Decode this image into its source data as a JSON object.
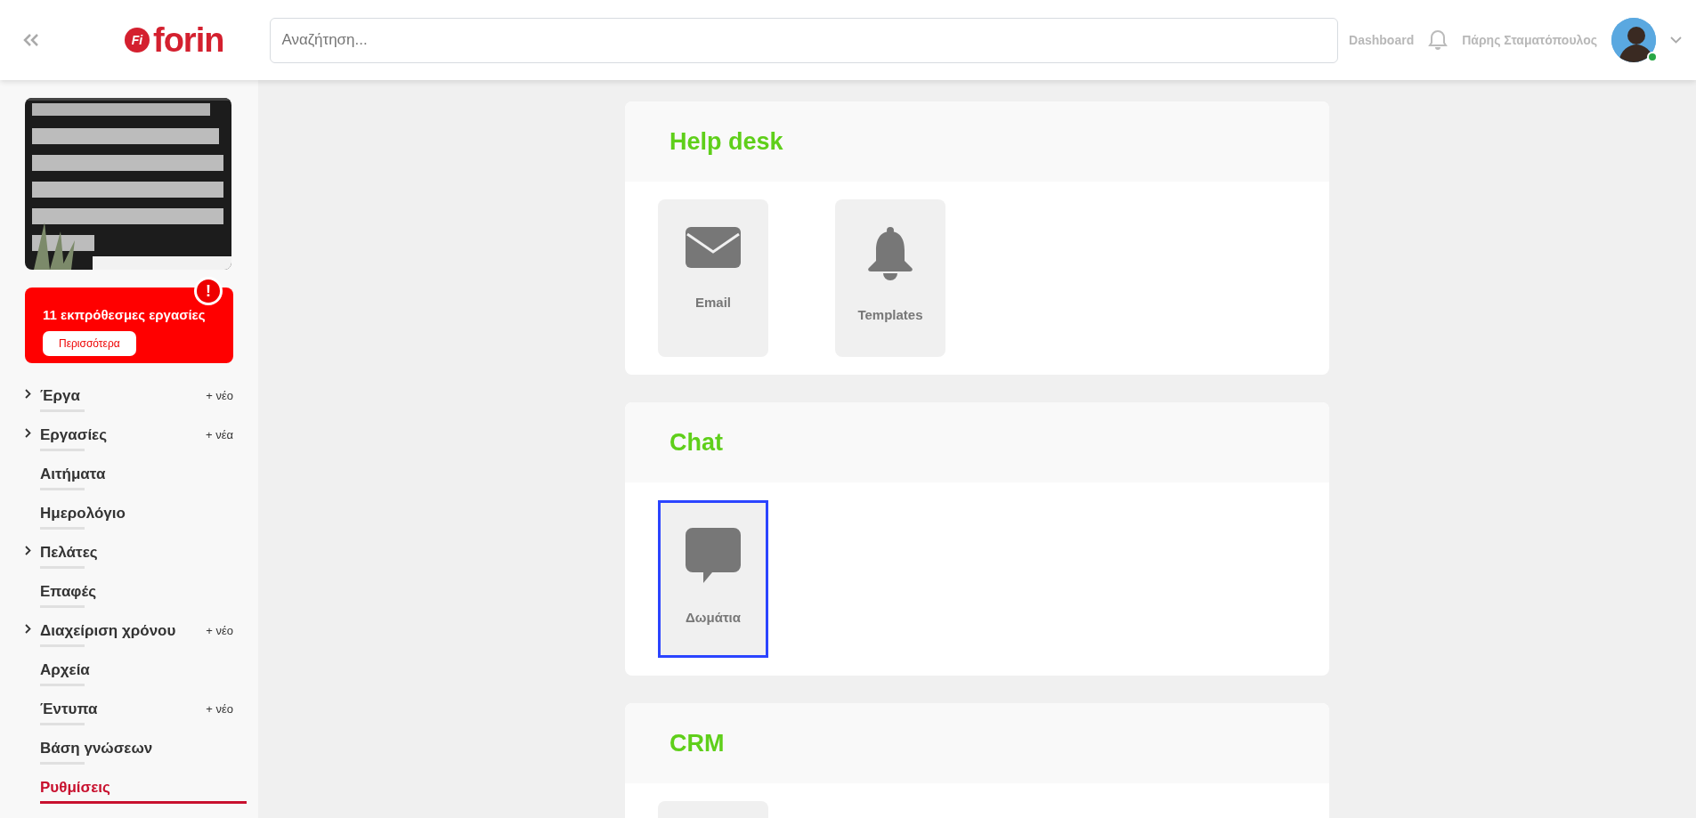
{
  "header": {
    "logo": {
      "mark": "Fi",
      "text": "forin"
    },
    "search": {
      "placeholder": "Αναζήτηση..."
    },
    "dashboard_link": "Dashboard",
    "user_name": "Πάρης Σταματόπουλος",
    "user_online": true
  },
  "sidebar": {
    "alert": {
      "text": "11 εκπρόθεσμες εργασίες",
      "badge": "!",
      "button": "Περισσότερα"
    },
    "items": [
      {
        "label": "Έργα",
        "expandable": true,
        "action": "+ νέο",
        "selected": false
      },
      {
        "label": "Εργασίες",
        "expandable": true,
        "action": "+ νέα",
        "selected": false
      },
      {
        "label": "Αιτήματα",
        "expandable": false,
        "selected": false
      },
      {
        "label": "Ημερολόγιο",
        "expandable": false,
        "selected": false
      },
      {
        "label": "Πελάτες",
        "expandable": true,
        "selected": false
      },
      {
        "label": "Επαφές",
        "expandable": false,
        "selected": false
      },
      {
        "label": "Διαχείριση χρόνου",
        "expandable": true,
        "action": "+ νέο",
        "selected": false
      },
      {
        "label": "Αρχεία",
        "expandable": false,
        "selected": false
      },
      {
        "label": "Έντυπα",
        "expandable": false,
        "action": "+ νέο",
        "selected": false
      },
      {
        "label": "Βάση γνώσεων",
        "expandable": false,
        "selected": false
      },
      {
        "label": "Ρυθμίσεις",
        "expandable": false,
        "selected": true
      }
    ]
  },
  "sections": [
    {
      "title": "Help desk",
      "tiles": [
        {
          "kind": "email",
          "label": "Email",
          "selected": false
        },
        {
          "kind": "bell",
          "label": "Templates",
          "selected": false
        }
      ]
    },
    {
      "title": "Chat",
      "tiles": [
        {
          "kind": "chat",
          "label": "Δωμάτια",
          "selected": true
        }
      ]
    },
    {
      "title": "CRM",
      "tiles": [
        {
          "kind": "blank",
          "selected": false
        }
      ]
    }
  ]
}
